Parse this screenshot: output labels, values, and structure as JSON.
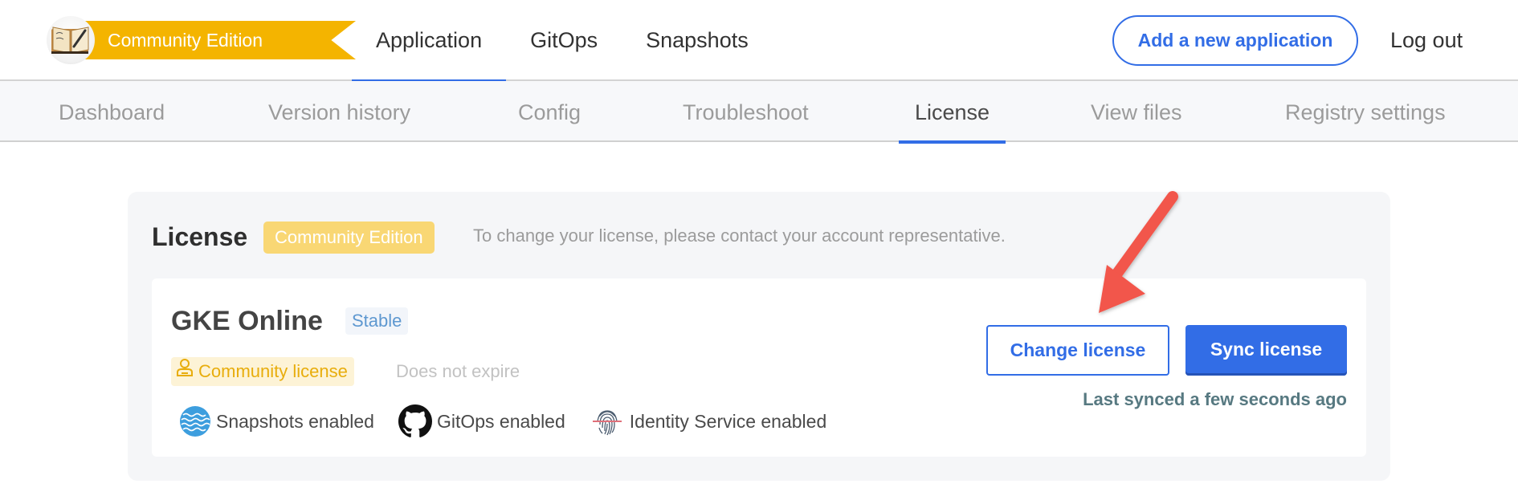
{
  "brand": {
    "edition_label": "Community Edition",
    "logo_icon": "guest-book-logo",
    "ribbon_color": "#f4b400"
  },
  "main_nav": {
    "items": [
      {
        "label": "Application",
        "active": true
      },
      {
        "label": "GitOps",
        "active": false
      },
      {
        "label": "Snapshots",
        "active": false
      }
    ],
    "add_app_label": "Add a new application",
    "logout_label": "Log out"
  },
  "sub_nav": {
    "items": [
      {
        "label": "Dashboard",
        "active": false
      },
      {
        "label": "Version history",
        "active": false
      },
      {
        "label": "Config",
        "active": false
      },
      {
        "label": "Troubleshoot",
        "active": false
      },
      {
        "label": "License",
        "active": true
      },
      {
        "label": "View files",
        "active": false
      },
      {
        "label": "Registry settings",
        "active": false
      }
    ]
  },
  "license": {
    "heading": "License",
    "edition_badge": "Community Edition",
    "note": "To change your license, please contact your account representative.",
    "app_name": "GKE Online",
    "channel": "Stable",
    "license_type": "Community license",
    "license_type_icon": "user-icon",
    "expiry": "Does not expire",
    "features": [
      {
        "label": "Snapshots enabled",
        "icon": "snapshots-waves-icon"
      },
      {
        "label": "GitOps enabled",
        "icon": "github-icon"
      },
      {
        "label": "Identity Service enabled",
        "icon": "fingerprint-icon"
      }
    ],
    "change_label": "Change license",
    "sync_label": "Sync license",
    "last_synced": "Last synced a few seconds ago"
  },
  "colors": {
    "accent": "#326de6",
    "warning": "#f4b400",
    "annotation_arrow": "#f2564b"
  }
}
